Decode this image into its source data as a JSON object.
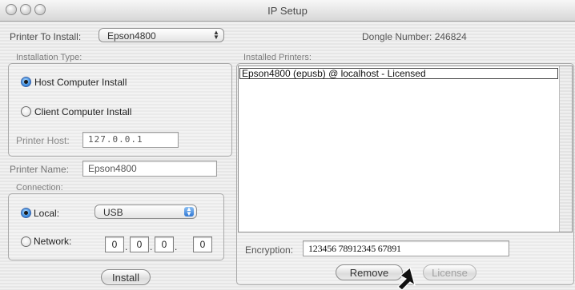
{
  "window": {
    "title": "IP Setup"
  },
  "printer_to_install": {
    "label": "Printer To Install:",
    "selected": "Epson4800"
  },
  "dongle": {
    "text": "Dongle Number: 246824"
  },
  "installation_type": {
    "label": "Installation Type:",
    "host_label": "Host Computer Install",
    "client_label": "Client Computer Install",
    "printer_host_label": "Printer Host:",
    "printer_host_value": "127.0.0.1"
  },
  "printer_name": {
    "label": "Printer Name:",
    "value": "Epson4800"
  },
  "connection": {
    "label": "Connection:",
    "local_label": "Local:",
    "local_selected": "USB",
    "network_label": "Network:",
    "ip": [
      "0",
      "0",
      "0",
      "0"
    ]
  },
  "install_button": "Install",
  "installed_printers": {
    "label": "Installed Printers:",
    "items": [
      "Epson4800 (epusb) @ localhost -  Licensed"
    ]
  },
  "encryption": {
    "label": "Encryption:",
    "value": "123456 78912345 67891"
  },
  "remove_button": "Remove",
  "license_button": "License"
}
